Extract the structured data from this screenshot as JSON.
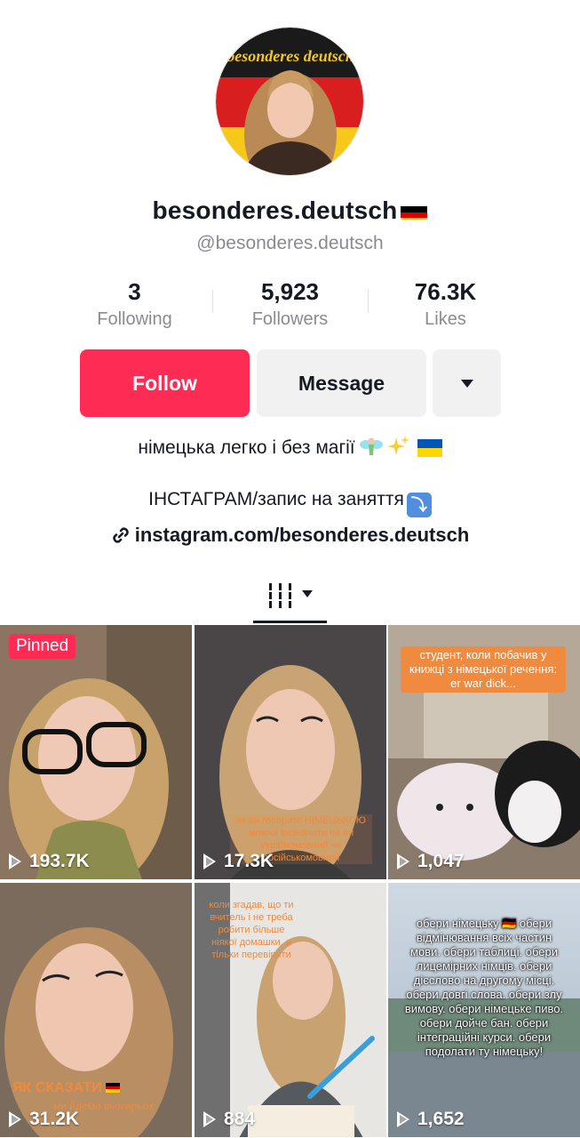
{
  "profile": {
    "display_name": "besonderes.deutsch",
    "handle": "@besonderes.deutsch",
    "avatar_text": "besonderes deutsch"
  },
  "stats": [
    {
      "value": "3",
      "label": "Following"
    },
    {
      "value": "5,923",
      "label": "Followers"
    },
    {
      "value": "76.3K",
      "label": "Likes"
    }
  ],
  "actions": {
    "follow": "Follow",
    "message": "Message"
  },
  "bio": {
    "line1": "німецька легко і без магії",
    "line2": "ІНСТАГРАМ/запис на заняття",
    "link": "instagram.com/besonderes.deutsch"
  },
  "videos": [
    {
      "views": "193.7K",
      "pinned": "Pinned"
    },
    {
      "views": "17.3K",
      "caption": "як ви говорите НІМЕЦЬКОЮ можна визначити чи ви україномовний чи російськомовний"
    },
    {
      "views": "1,047",
      "caption": "студент, коли побачив у книжці з німецької речення: er war dick..."
    },
    {
      "views": "31.2K",
      "caption": "ЯК СКАЗАТИ",
      "caption_sub": "ми йдемо вчотирьох"
    },
    {
      "views": "884",
      "caption": "коли згадав, що ти вчитель і не треба робити більше ніякої домашки, а тільки перевіряти"
    },
    {
      "views": "1,652",
      "caption": "обери німецьку 🇩🇪 обери відмінювання всіх частин мови. обери таблиці. обери лицемірних німців. обери дієслово на другому місці. обери довгі слова. обери злу вимову. обери німецьке пиво. обери дойче бан. обери інтеграційні курси. обери подолати ту німецьку!"
    }
  ],
  "colors": {
    "accent": "#fe2c55",
    "button_gray": "#f1f1f2",
    "muted_text": "#8a8b91",
    "caption_orange": "#f08a3e"
  },
  "icons": {
    "more": "chevron-down-icon",
    "link": "link-icon",
    "grid_tab": "grid-icon",
    "play": "play-icon"
  }
}
